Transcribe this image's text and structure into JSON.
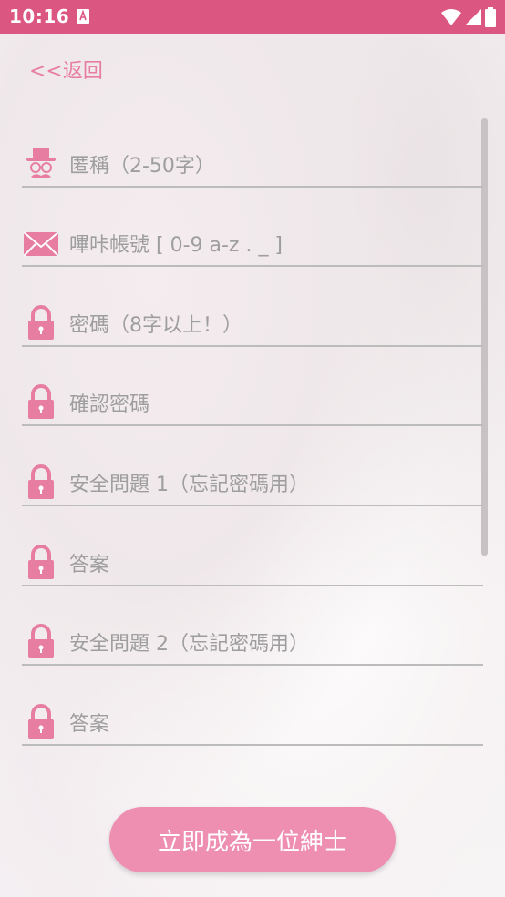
{
  "status_bar": {
    "time": "10:16",
    "background": "#dc5682",
    "icons": [
      "a-notification-icon",
      "wifi-icon",
      "signal-icon",
      "battery-icon"
    ]
  },
  "back": {
    "label": "<<返回"
  },
  "fields": [
    {
      "icon": "gentleman-hat-icon",
      "placeholder": "匿稱（2-50字）"
    },
    {
      "icon": "envelope-icon",
      "placeholder": "嗶咔帳號 [ 0-9 a-z . _ ]"
    },
    {
      "icon": "lock-icon",
      "placeholder": "密碼（8字以上！）"
    },
    {
      "icon": "lock-icon",
      "placeholder": "確認密碼"
    },
    {
      "icon": "lock-icon",
      "placeholder": "安全問題 1（忘記密碼用）"
    },
    {
      "icon": "lock-icon",
      "placeholder": "答案"
    },
    {
      "icon": "lock-icon",
      "placeholder": "安全問題 2（忘記密碼用）"
    },
    {
      "icon": "lock-icon",
      "placeholder": "答案"
    }
  ],
  "submit": {
    "label": "立即成為一位紳士"
  },
  "colors": {
    "accent": "#e77ea2",
    "button": "#ee8fb2",
    "underline": "#bcbcbc",
    "placeholder": "#9e9e9e"
  }
}
